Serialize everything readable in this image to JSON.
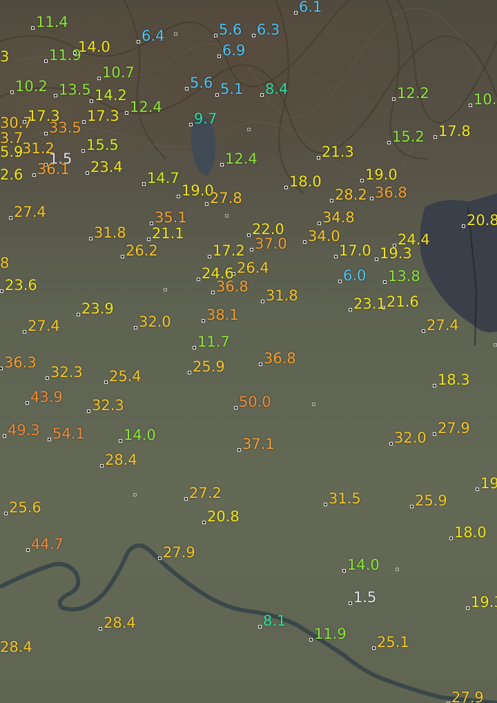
{
  "colors": {
    "cyan": "#4fc3f7",
    "teal": "#2fe0a0",
    "green": "#8ee63c",
    "lime": "#c8f01e",
    "yellow": "#f2e51e",
    "gold": "#f7c62a",
    "orange": "#f4a032",
    "deep_orange": "#ef8a3c",
    "white": "#e4e4ea"
  },
  "readings": [
    {
      "v": "6.1",
      "c": "cyan"
    },
    {
      "v": "11.4",
      "c": "green"
    },
    {
      "v": "6.4",
      "c": "cyan"
    },
    {
      "v": "5.6",
      "c": "cyan"
    },
    {
      "v": "6.3",
      "c": "cyan"
    },
    {
      "v": "11.9",
      "c": "green"
    },
    {
      "v": "14.0",
      "c": "yellow"
    },
    {
      "v": "6.9",
      "c": "cyan"
    },
    {
      "v": "10.7",
      "c": "green"
    },
    {
      "v": "5.6",
      "c": "cyan"
    },
    {
      "v": "10.2",
      "c": "green"
    },
    {
      "v": "13.5",
      "c": "green"
    },
    {
      "v": "14.2",
      "c": "lime"
    },
    {
      "v": "5.1",
      "c": "cyan"
    },
    {
      "v": "8.4",
      "c": "teal"
    },
    {
      "v": "12.2",
      "c": "green"
    },
    {
      "v": "12.4",
      "c": "green"
    },
    {
      "v": "9.7",
      "c": "teal"
    },
    {
      "v": "17.3",
      "c": "yellow"
    },
    {
      "v": "17.3",
      "c": "yellow"
    },
    {
      "v": "33.5",
      "c": "orange"
    },
    {
      "v": "17.8",
      "c": "yellow"
    },
    {
      "v": "15.2",
      "c": "green"
    },
    {
      "v": "31.2",
      "c": "gold"
    },
    {
      "v": "15.5",
      "c": "lime"
    },
    {
      "v": "21.3",
      "c": "yellow"
    },
    {
      "v": "1.5",
      "c": "white"
    },
    {
      "v": "12.4",
      "c": "green"
    },
    {
      "v": "36.1",
      "c": "orange"
    },
    {
      "v": "23.4",
      "c": "yellow"
    },
    {
      "v": "19.0",
      "c": "yellow"
    },
    {
      "v": "14.7",
      "c": "lime"
    },
    {
      "v": "18.0",
      "c": "yellow"
    },
    {
      "v": "36.8",
      "c": "orange"
    },
    {
      "v": "19.0",
      "c": "yellow"
    },
    {
      "v": "28.2",
      "c": "gold"
    },
    {
      "v": "27.8",
      "c": "gold"
    },
    {
      "v": "27.4",
      "c": "gold"
    },
    {
      "v": "35.1",
      "c": "orange"
    },
    {
      "v": "34.8",
      "c": "gold"
    },
    {
      "v": "20.8",
      "c": "yellow"
    },
    {
      "v": "31.8",
      "c": "gold"
    },
    {
      "v": "21.1",
      "c": "yellow"
    },
    {
      "v": "22.0",
      "c": "yellow"
    },
    {
      "v": "34.0",
      "c": "gold"
    },
    {
      "v": "24.4",
      "c": "yellow"
    },
    {
      "v": "37.0",
      "c": "orange"
    },
    {
      "v": "26.2",
      "c": "gold"
    },
    {
      "v": "17.2",
      "c": "yellow"
    },
    {
      "v": "17.0",
      "c": "yellow"
    },
    {
      "v": "19.3",
      "c": "yellow"
    },
    {
      "v": "26.4",
      "c": "gold"
    },
    {
      "v": "24.6",
      "c": "yellow"
    },
    {
      "v": "6.0",
      "c": "cyan"
    },
    {
      "v": "13.8",
      "c": "green"
    },
    {
      "v": "23.6",
      "c": "yellow"
    },
    {
      "v": "36.8",
      "c": "orange"
    },
    {
      "v": "31.8",
      "c": "gold"
    },
    {
      "v": "21.6",
      "c": "yellow"
    },
    {
      "v": "23.1",
      "c": "yellow"
    },
    {
      "v": "23.9",
      "c": "yellow"
    },
    {
      "v": "38.1",
      "c": "orange"
    },
    {
      "v": "32.0",
      "c": "gold"
    },
    {
      "v": "27.4",
      "c": "gold"
    },
    {
      "v": "27.4",
      "c": "gold"
    },
    {
      "v": "11.7",
      "c": "green"
    },
    {
      "v": "36.3",
      "c": "orange"
    },
    {
      "v": "36.8",
      "c": "orange"
    },
    {
      "v": "25.9",
      "c": "gold"
    },
    {
      "v": "32.3",
      "c": "gold"
    },
    {
      "v": "25.4",
      "c": "gold"
    },
    {
      "v": "18.3",
      "c": "yellow"
    },
    {
      "v": "43.9",
      "c": "deep_orange"
    },
    {
      "v": "32.3",
      "c": "gold"
    },
    {
      "v": "50.0",
      "c": "deep_orange"
    },
    {
      "v": "49.3",
      "c": "deep_orange"
    },
    {
      "v": "54.1",
      "c": "deep_orange"
    },
    {
      "v": "14.0",
      "c": "green"
    },
    {
      "v": "27.9",
      "c": "gold"
    },
    {
      "v": "32.0",
      "c": "gold"
    },
    {
      "v": "37.1",
      "c": "orange"
    },
    {
      "v": "28.4",
      "c": "gold"
    },
    {
      "v": "19",
      "c": "yellow"
    },
    {
      "v": "27.2",
      "c": "gold"
    },
    {
      "v": "31.5",
      "c": "gold"
    },
    {
      "v": "25.9",
      "c": "gold"
    },
    {
      "v": "25.6",
      "c": "gold"
    },
    {
      "v": "20.8",
      "c": "yellow"
    },
    {
      "v": "18.0",
      "c": "yellow"
    },
    {
      "v": "44.7",
      "c": "deep_orange"
    },
    {
      "v": "27.9",
      "c": "gold"
    },
    {
      "v": "14.0",
      "c": "green"
    },
    {
      "v": "1.5",
      "c": "white"
    },
    {
      "v": "19.3",
      "c": "yellow"
    },
    {
      "v": "8.1",
      "c": "teal"
    },
    {
      "v": "28.4",
      "c": "gold"
    },
    {
      "v": "11.9",
      "c": "green"
    },
    {
      "v": "25.1",
      "c": "gold"
    },
    {
      "v": "28.4",
      "c": "gold"
    },
    {
      "v": "27.9",
      "c": "gold"
    },
    {
      "v": "3",
      "c": "yellow"
    },
    {
      "v": "10.",
      "c": "green"
    },
    {
      "v": "30.7",
      "c": "gold"
    },
    {
      "v": "3.7",
      "c": "gold"
    },
    {
      "v": "5.9",
      "c": "yellow"
    },
    {
      "v": "2.6",
      "c": "yellow"
    },
    {
      "v": "8",
      "c": "gold"
    }
  ]
}
